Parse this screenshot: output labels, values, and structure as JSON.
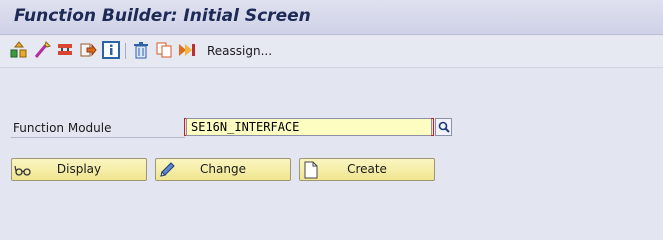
{
  "title": "Function Builder: Initial Screen",
  "toolbar": {
    "icons": [
      "other-object-icon",
      "magic-wand-icon",
      "where-used-icon",
      "navigate-icon",
      "info-icon",
      "delete-icon",
      "copy-icon",
      "rename-icon"
    ],
    "reassign_label": "Reassign..."
  },
  "form": {
    "function_module_label": "Function Module",
    "function_module_value": "SE16N_INTERFACE"
  },
  "buttons": {
    "display_label": "Display",
    "change_label": "Change",
    "create_label": "Create"
  },
  "colors": {
    "background": "#e3e6f0",
    "title_text": "#1c2a55",
    "input_bg": "#fdfdc2",
    "button_bg": "#f0e58f",
    "required_mark": "#d21b1b"
  }
}
